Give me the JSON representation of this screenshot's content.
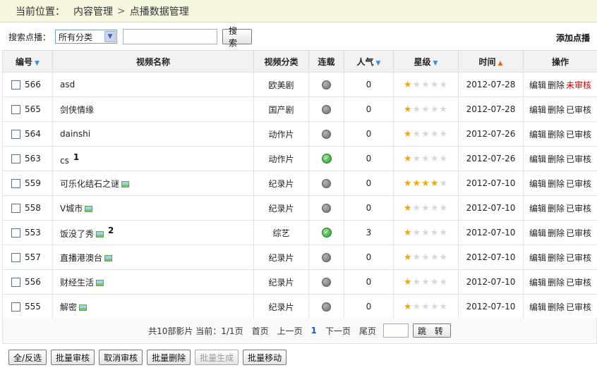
{
  "breadcrumb": {
    "label": "当前位置：",
    "items": [
      "内容管理",
      "点播数据管理"
    ],
    "separator": ">"
  },
  "search": {
    "label": "搜索点播：",
    "category_selected": "所有分类",
    "input_value": "",
    "button_label": "搜 索"
  },
  "add_link": "添加点播",
  "table": {
    "headers": [
      "编号",
      "视频名称",
      "视频分类",
      "连载",
      "人气",
      "星级",
      "时间",
      "操作"
    ],
    "rows": [
      {
        "id": "566",
        "name": "asd",
        "category": "欧美剧",
        "serial": "off",
        "popularity": "0",
        "stars": 1,
        "date": "2012-07-28",
        "edit": "编辑",
        "delete": "删除",
        "status": "未审核",
        "img": false,
        "annot": ""
      },
      {
        "id": "565",
        "name": "剑侠情缘",
        "category": "国产剧",
        "serial": "off",
        "popularity": "0",
        "stars": 1,
        "date": "2012-07-28",
        "edit": "编辑",
        "delete": "删除",
        "status": "已审核",
        "img": false,
        "annot": ""
      },
      {
        "id": "564",
        "name": "dainshi",
        "category": "动作片",
        "serial": "off",
        "popularity": "0",
        "stars": 1,
        "date": "2012-07-26",
        "edit": "编辑",
        "delete": "删除",
        "status": "已审核",
        "img": false,
        "annot": ""
      },
      {
        "id": "563",
        "name": "cs",
        "category": "动作片",
        "serial": "on",
        "popularity": "0",
        "stars": 1,
        "date": "2012-07-26",
        "edit": "编辑",
        "delete": "删除",
        "status": "已审核",
        "img": false,
        "annot": "1"
      },
      {
        "id": "559",
        "name": "可乐化结石之谜",
        "category": "纪录片",
        "serial": "off",
        "popularity": "0",
        "stars": 4,
        "date": "2012-07-10",
        "edit": "编辑",
        "delete": "删除",
        "status": "已审核",
        "img": true,
        "annot": ""
      },
      {
        "id": "558",
        "name": "V城市",
        "category": "纪录片",
        "serial": "off",
        "popularity": "0",
        "stars": 1,
        "date": "2012-07-10",
        "edit": "编辑",
        "delete": "删除",
        "status": "已审核",
        "img": true,
        "annot": ""
      },
      {
        "id": "553",
        "name": "饭没了秀",
        "category": "综艺",
        "serial": "on",
        "popularity": "3",
        "stars": 1,
        "date": "2012-07-10",
        "edit": "编辑",
        "delete": "删除",
        "status": "已审核",
        "img": true,
        "annot": "2"
      },
      {
        "id": "557",
        "name": "直播港澳台",
        "category": "纪录片",
        "serial": "off",
        "popularity": "0",
        "stars": 1,
        "date": "2012-07-10",
        "edit": "编辑",
        "delete": "删除",
        "status": "已审核",
        "img": true,
        "annot": ""
      },
      {
        "id": "556",
        "name": "财经生活",
        "category": "纪录片",
        "serial": "off",
        "popularity": "0",
        "stars": 1,
        "date": "2012-07-10",
        "edit": "编辑",
        "delete": "删除",
        "status": "已审核",
        "img": true,
        "annot": ""
      },
      {
        "id": "555",
        "name": "解密",
        "category": "纪录片",
        "serial": "off",
        "popularity": "0",
        "stars": 1,
        "date": "2012-07-10",
        "edit": "编辑",
        "delete": "删除",
        "status": "已审核",
        "img": true,
        "annot": ""
      }
    ]
  },
  "pager": {
    "summary": "共10部影片 当前：1/1页",
    "first": "首页",
    "prev": "上一页",
    "current": "1",
    "next": "下一页",
    "last": "尾页",
    "jump_label": "跳 转",
    "page_input": ""
  },
  "bottom_buttons": [
    "全/反选",
    "批量审核",
    "取消审核",
    "批量删除",
    "批量生成",
    "批量移动"
  ],
  "colors": {
    "pending": "#d10000",
    "accent_star": "#f4a900",
    "serial_on": "#2e9a2e"
  }
}
